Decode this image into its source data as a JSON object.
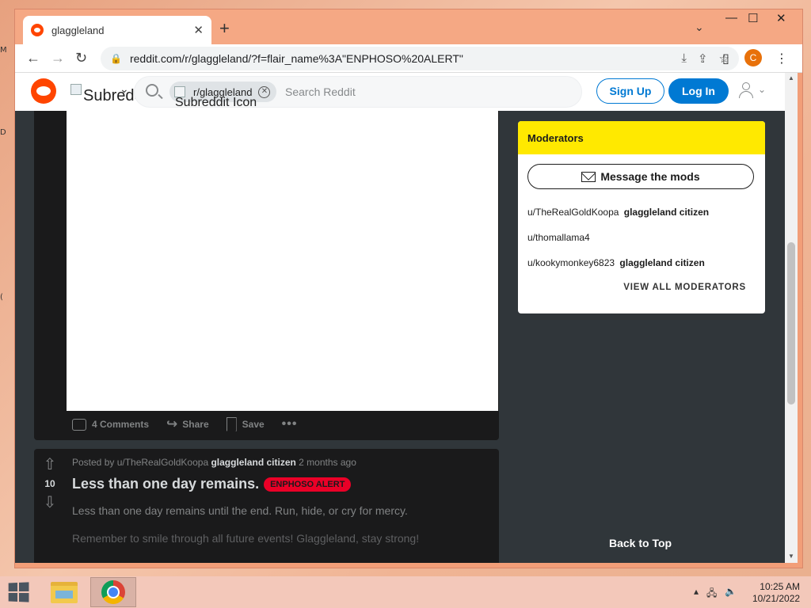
{
  "desktop": {
    "glyphs": [
      "M",
      "D",
      "("
    ]
  },
  "browser": {
    "tab": {
      "title": "glaggleland",
      "close": "✕"
    },
    "new_tab": "+",
    "tab_search": "⌄",
    "window_controls": {
      "minimize": "—",
      "maximize": "☐",
      "close": "✕"
    },
    "nav": {
      "back": "←",
      "forward": "→",
      "reload": "↻"
    },
    "url": "reddit.com/r/glaggleland/?f=flair_name%3A\"ENPHOSO%20ALERT\"",
    "profile_initial": "C"
  },
  "reddit_header": {
    "subreddit_alt": "Subreddit",
    "search_chip": "r/glaggleland",
    "chip_image_alt": "Subreddit Icon",
    "search_placeholder": "Search Reddit",
    "signup": "Sign Up",
    "login": "Log In"
  },
  "post1": {
    "actions": {
      "comments": "4 Comments",
      "share": "Share",
      "save": "Save",
      "more": "•••"
    }
  },
  "post2": {
    "votes": "10",
    "posted_by": "Posted by u/TheRealGoldKoopa",
    "user_flair": "glaggleland citizen",
    "time": "2 months ago",
    "title": "Less than one day remains.",
    "flair": "ENPHOSO ALERT",
    "body1": "Less than one day remains until the end. Run, hide, or cry for mercy.",
    "body2": "Remember to smile through all future events! Glaggleland, stay strong!"
  },
  "sidebar": {
    "moderators_title": "Moderators",
    "message_button": "Message the mods",
    "mods": [
      {
        "name": "u/TheRealGoldKoopa",
        "flair": "glaggleland citizen"
      },
      {
        "name": "u/thomallama4",
        "flair": ""
      },
      {
        "name": "u/kookymonkey6823",
        "flair": "glaggleland citizen"
      }
    ],
    "view_all": "VIEW ALL MODERATORS",
    "back_to_top": "Back to Top"
  },
  "taskbar": {
    "time": "10:25 AM",
    "date": "10/21/2022"
  },
  "colors": {
    "accent": "#0079d3",
    "flair": "#ea0027",
    "mod_header": "#ffe900",
    "reddit_orange": "#ff4500"
  }
}
